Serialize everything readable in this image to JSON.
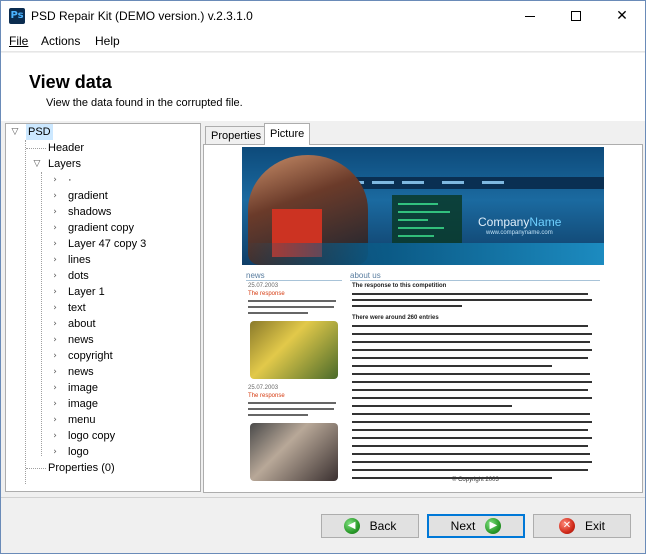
{
  "window": {
    "title": "PSD Repair Kit (DEMO version.) v.2.3.1.0",
    "app_icon_text": "Ps"
  },
  "menu": {
    "file": "File",
    "actions": "Actions",
    "help": "Help"
  },
  "header": {
    "title": "View data",
    "subtitle": "View the data found in the corrupted file."
  },
  "tree": {
    "root": "PSD",
    "header": "Header",
    "layers": "Layers",
    "layer_items": [
      "·",
      "gradient",
      "shadows",
      "gradient copy",
      "Layer 47 copy 3",
      "lines",
      "dots",
      "Layer 1",
      "text",
      "about",
      "news",
      "copyright",
      "news",
      "image",
      "image",
      "menu",
      "logo copy",
      "logo"
    ],
    "properties": "Properties (0)"
  },
  "tabs": {
    "properties": "Properties",
    "picture": "Picture"
  },
  "preview": {
    "company_name_part1": "Company",
    "company_name_part2": "Name",
    "company_url": "www.companyname.com",
    "news_heading": "news",
    "about_heading": "about us",
    "news1_date": "25.07.2003",
    "news1_title": "The response",
    "news2_date": "25.07.2003",
    "news2_title": "The response",
    "about_bold1": "The response to this competition",
    "about_bold2": "There were around 260 entries",
    "copyright": "© Copyright 2003"
  },
  "buttons": {
    "back": "Back",
    "next": "Next",
    "exit": "Exit"
  },
  "colors": {
    "accent": "#0078d7",
    "selection": "#cce8ff",
    "banner": "#0d4a7a"
  }
}
